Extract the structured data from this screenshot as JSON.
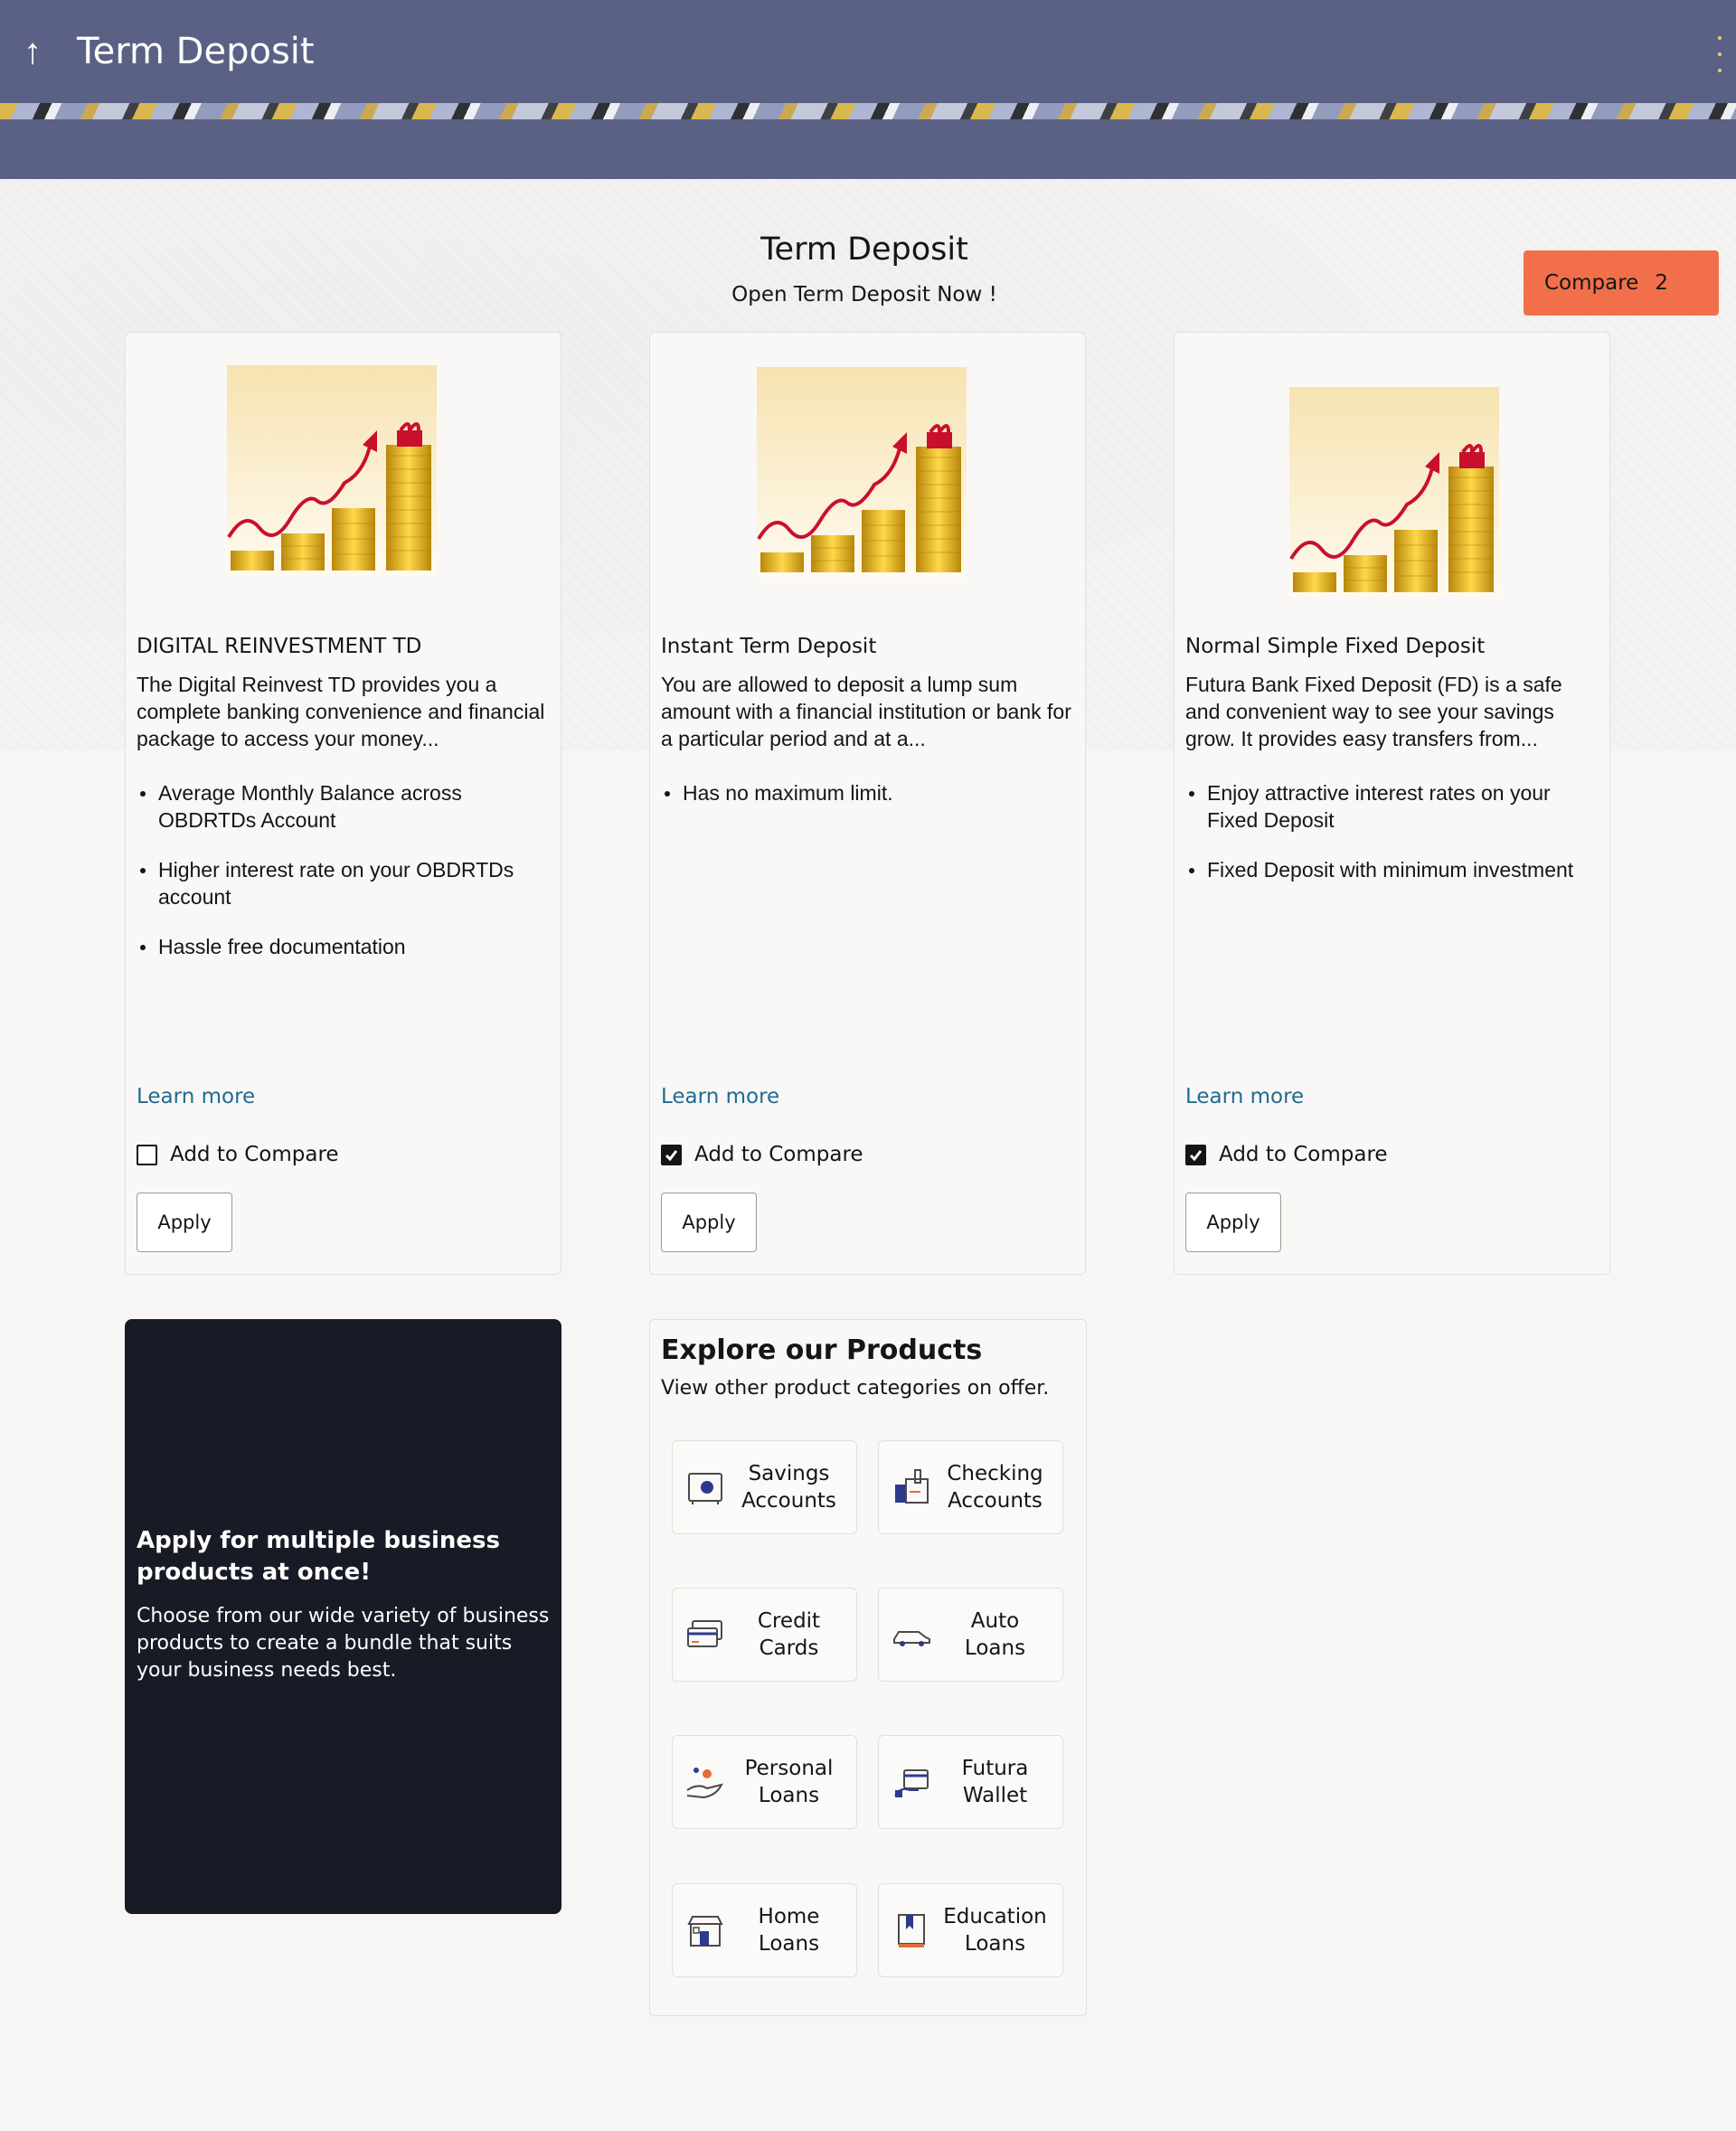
{
  "header": {
    "back_icon": "arrow-up-icon",
    "title": "Term Deposit",
    "menu_icon": "kebab-menu-icon"
  },
  "main": {
    "heading": "Term Deposit",
    "subheading": "Open Term Deposit Now !",
    "compare_button": {
      "label": "Compare",
      "count": "2",
      "color": "#f1704b"
    }
  },
  "products": [
    {
      "name": "DIGITAL REINVESTMENT TD",
      "description": "The Digital Reinvest TD provides you a complete banking convenience and financial package to access your money...",
      "features": [
        "Average Monthly Balance across OBDRTDs Account",
        "Higher interest rate on your OBDRTDs account",
        "Hassle free documentation"
      ],
      "learn_more": "Learn more",
      "compare_label": "Add to Compare",
      "compare_checked": false,
      "apply_label": "Apply"
    },
    {
      "name": "Instant Term Deposit",
      "description": "You are allowed to deposit a lump sum amount with a financial institution or bank for a particular period and at a...",
      "features": [
        "Has no maximum limit."
      ],
      "learn_more": "Learn more",
      "compare_label": "Add to Compare",
      "compare_checked": true,
      "apply_label": "Apply"
    },
    {
      "name": "Normal Simple Fixed Deposit",
      "description": "Futura Bank Fixed Deposit (FD) is a safe and convenient way to see your savings grow. It provides easy transfers from...",
      "features": [
        "Enjoy attractive interest rates on your Fixed Deposit",
        "Fixed Deposit with minimum investment"
      ],
      "learn_more": "Learn more",
      "compare_label": "Add to Compare",
      "compare_checked": true,
      "apply_label": "Apply"
    }
  ],
  "business_panel": {
    "title": "Apply for multiple business products at once!",
    "text": "Choose from our wide variety of business products to create a bundle that suits your business needs best."
  },
  "explore": {
    "title": "Explore our Products",
    "subtitle": "View other product categories on offer.",
    "categories": [
      {
        "label": "Savings\nAccounts",
        "icon": "safe-icon"
      },
      {
        "label": "Checking\nAccounts",
        "icon": "checking-icon"
      },
      {
        "label": "Credit\nCards",
        "icon": "credit-card-icon"
      },
      {
        "label": "Auto\nLoans",
        "icon": "car-icon"
      },
      {
        "label": "Personal\nLoans",
        "icon": "hand-coin-icon"
      },
      {
        "label": "Futura\nWallet",
        "icon": "wallet-icon"
      },
      {
        "label": "Home\nLoans",
        "icon": "house-icon"
      },
      {
        "label": "Education\nLoans",
        "icon": "book-icon"
      }
    ]
  },
  "colors": {
    "header_bg": "#5a6184",
    "accent": "#f1704b",
    "link": "#1f6b94",
    "dark_panel": "#181b26"
  }
}
